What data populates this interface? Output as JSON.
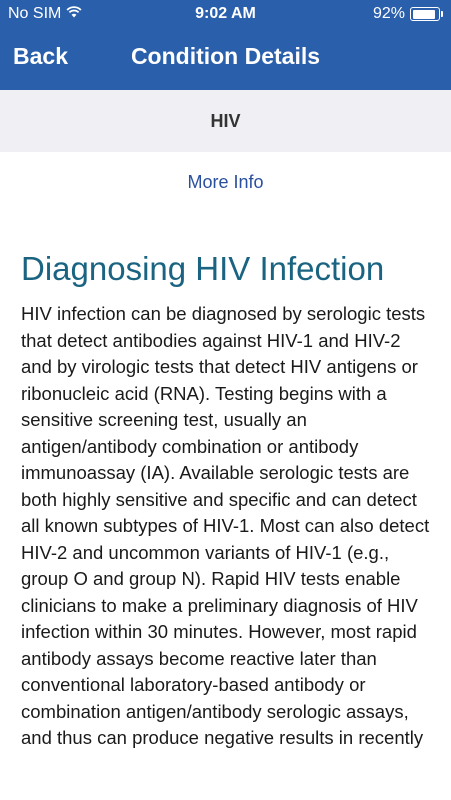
{
  "status_bar": {
    "carrier": "No SIM",
    "time": "9:02 AM",
    "battery_percent": "92%",
    "battery_level": 0.92,
    "wifi_icon": "wifi-icon",
    "battery_icon": "battery-icon"
  },
  "nav": {
    "back_label": "Back",
    "title": "Condition Details"
  },
  "subheader": {
    "title": "HIV"
  },
  "link": {
    "more_info": "More Info"
  },
  "article": {
    "heading": "Diagnosing HIV Infection",
    "body": "HIV infection can be diagnosed by serologic tests that detect antibodies against HIV-1 and HIV-2 and by virologic tests that detect HIV antigens or ribonucleic acid (RNA). Testing begins with a sensitive screening test, usually an antigen/antibody combination or antibody immunoassay (IA). Available serologic tests are both highly sensitive and specific and can detect all known subtypes of HIV-1. Most can also detect HIV-2 and uncommon variants of HIV-1 (e.g., group O and group N). Rapid HIV tests enable clinicians to make a preliminary diagnosis of HIV infection within 30 minutes. However, most rapid antibody assays become reactive later than conventional laboratory-based antibody or combination antigen/antibody serologic assays, and thus can produce negative results in recently"
  },
  "colors": {
    "header_bg": "#2a5fab",
    "subheader_bg": "#efeff4",
    "link": "#2a4f9e",
    "heading": "#1a6482"
  }
}
